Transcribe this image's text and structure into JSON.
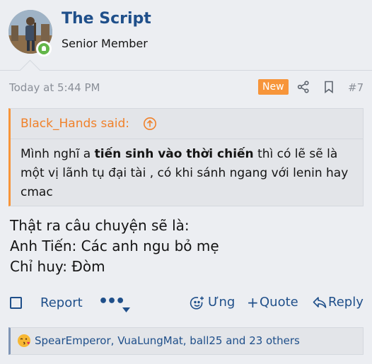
{
  "user": {
    "name": "The Script",
    "title": "Senior Member"
  },
  "post": {
    "time": "Today at 5:44 PM",
    "badge": "New",
    "number": "#7"
  },
  "quote": {
    "author": "Black_Hands said:",
    "text_before": "Mình nghĩ a ",
    "text_bold": "tiến sinh vào thời chiến",
    "text_after": " thì có lẽ sẽ là một vị lãnh tụ đại tài , có khi sánh ngang với lenin hay cmac"
  },
  "body_lines": [
    "Thật ra câu chuyện sẽ là:",
    "Anh Tiến: Các anh ngu bỏ mẹ",
    "Chỉ huy: Đòm"
  ],
  "actions": {
    "report": "Report",
    "more": "•••",
    "react": "Ưng",
    "quote": "Quote",
    "reply": "Reply"
  },
  "reactions": {
    "text": "SpearEmperor, VuaLungMat, ball25 and 23 others"
  },
  "icons": {
    "online": "online-user-icon",
    "share": "share-icon",
    "bookmark": "bookmark-icon",
    "quote_jump": "arrow-up-circle-icon",
    "more_caret": "caret-down-icon",
    "react": "smiley-plus-icon",
    "reply": "reply-arrow-icon",
    "reaction": "kiss-emoji-icon"
  },
  "colors": {
    "accent": "#1f4f8a",
    "badge": "#f7953a",
    "quote_author": "#f0812a",
    "online": "#63b649",
    "background": "#eceef2"
  }
}
